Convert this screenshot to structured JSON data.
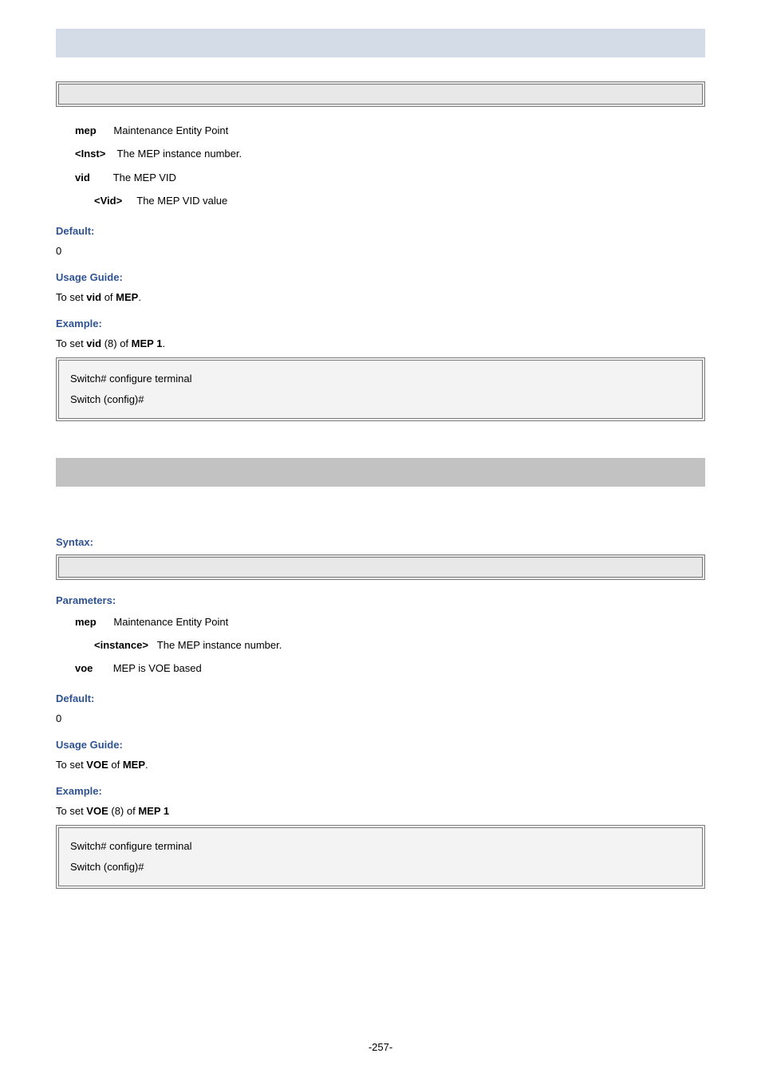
{
  "section1": {
    "params": {
      "mep_bold": "mep",
      "mep_desc": "Maintenance Entity Point",
      "inst_bold": "<Inst>",
      "inst_desc": " The MEP instance number.",
      "vid_bold": "vid",
      "vid_desc": "The MEP VID",
      "vidval_bold": "<Vid>",
      "vidval_desc": "The MEP VID value"
    },
    "default_label": "Default:",
    "default_val": "0",
    "usage_label": "Usage Guide:",
    "usage_text_a": "To set ",
    "usage_bold_a": "vid",
    "usage_text_b": " of ",
    "usage_bold_b": "MEP",
    "usage_text_c": ".",
    "example_label": "Example:",
    "example_text_a": "To set ",
    "example_bold_a": "vid",
    "example_text_b": " (8) of ",
    "example_bold_b": "MEP 1",
    "example_text_c": ".",
    "code1": "Switch# configure terminal",
    "code2": "Switch (config)# "
  },
  "section2": {
    "syntax_label": "Syntax:",
    "params_label": "Parameters:",
    "params": {
      "mep_bold": "mep",
      "mep_desc": "Maintenance Entity Point",
      "instance_bold": "<instance>",
      "instance_desc": "The MEP instance number.",
      "voe_bold": "voe",
      "voe_desc": "MEP is VOE based"
    },
    "default_label": "Default:",
    "default_val": "0",
    "usage_label": "Usage Guide:",
    "usage_text_a": "To set ",
    "usage_bold_a": "VOE",
    "usage_text_b": " of ",
    "usage_bold_b": "MEP",
    "usage_text_c": ".",
    "example_label": "Example:",
    "example_text_a": "To set ",
    "example_bold_a": "VOE",
    "example_text_b": " (8) of ",
    "example_bold_b": "MEP 1",
    "code1": "Switch# configure terminal",
    "code2": "Switch (config)# "
  },
  "footer": "-257-"
}
